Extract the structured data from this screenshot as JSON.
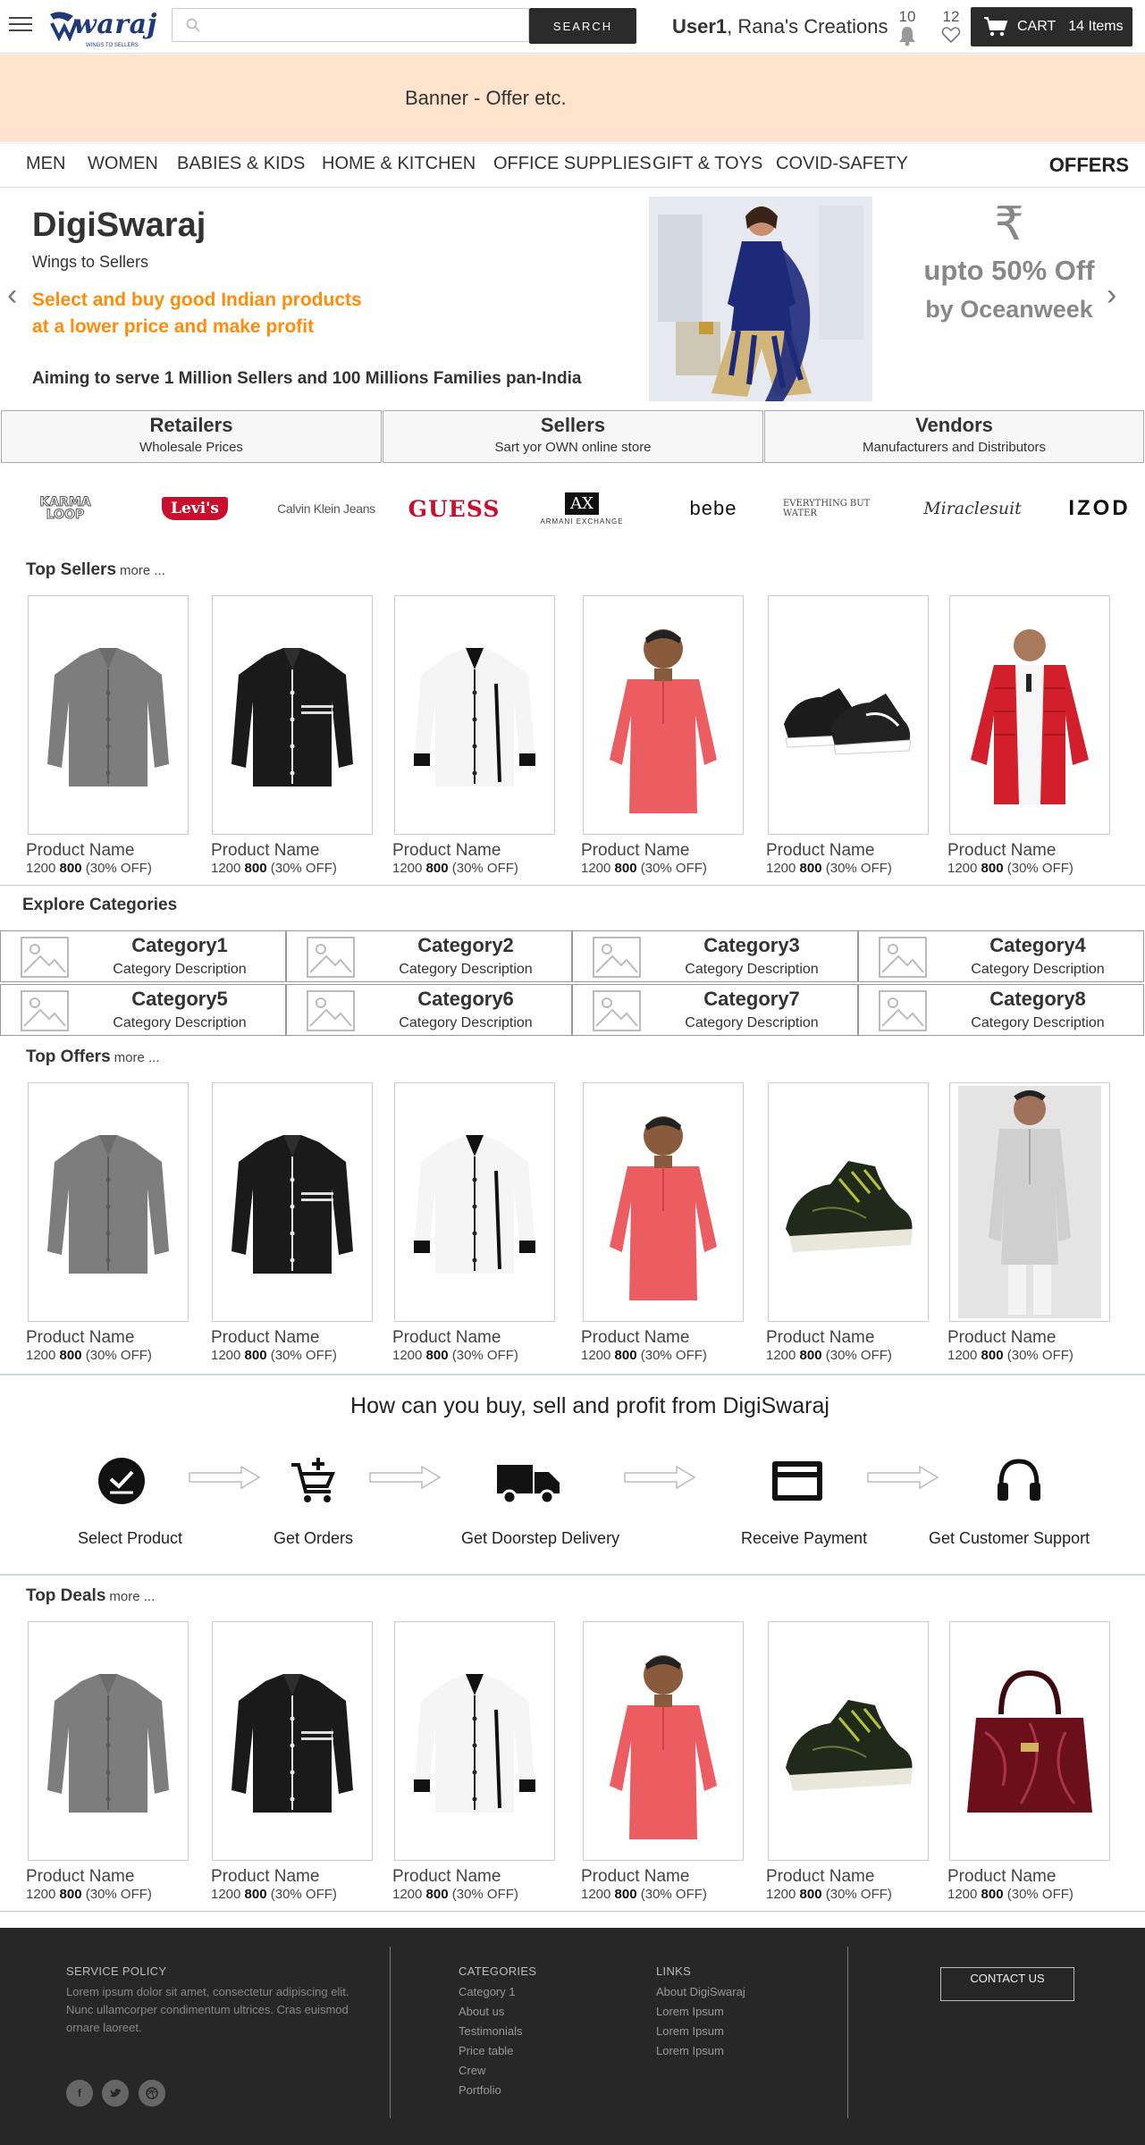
{
  "header": {
    "search_placeholder": "",
    "search_button": "SEARCH",
    "user_bold": "User1",
    "user_rest": ", Rana's Creations",
    "notifications_count": "10",
    "wishlist_count": "12",
    "cart_label": "CART",
    "cart_items": "14 Items"
  },
  "logo": {
    "text": "waraj"
  },
  "banner": {
    "text": "Banner - Offer etc."
  },
  "nav": {
    "items": [
      "MEN",
      "WOMEN",
      "BABIES & KIDS",
      "HOME & KITCHEN",
      "OFFICE SUPPLIES",
      "GIFT & TOYS",
      "COVID-SAFETY"
    ],
    "offers": "OFFERS"
  },
  "hero": {
    "title": "DigiSwaraj",
    "subtitle": "Wings to Sellers",
    "tagline_1": "Select and buy good Indian products",
    "tagline_2": "at a lower price and make profit",
    "aim": "Aiming to serve 1 Million Sellers and 100 Millions Families pan-India",
    "rupee": "₹",
    "offer": "upto 50% Off",
    "offer_by": "by Oceanweek",
    "prev": "‹",
    "next": "›"
  },
  "segments": [
    {
      "title": "Retailers",
      "desc": "Wholesale Prices"
    },
    {
      "title": "Sellers",
      "desc": "Sart yor OWN online store"
    },
    {
      "title": "Vendors",
      "desc": "Manufacturers and Distributors"
    }
  ],
  "brands": [
    "KARMA LOOP",
    "Levi's",
    "Calvin Klein Jeans",
    "GUESS",
    "AX",
    "ARMANI EXCHANGE",
    "bebe",
    "EVERYTHING BUT WATER",
    "Miraclesuit",
    "IZOD"
  ],
  "top_sellers": {
    "title": "Top Sellers",
    "more": "more ...",
    "products": [
      {
        "name": "Product Name",
        "mrp": "1200",
        "price": "800",
        "off": "(30% OFF)",
        "image": "grey-shirt"
      },
      {
        "name": "Product Name",
        "mrp": "1200",
        "price": "800",
        "off": "(30% OFF)",
        "image": "black-shirt"
      },
      {
        "name": "Product Name",
        "mrp": "1200",
        "price": "800",
        "off": "(30% OFF)",
        "image": "white-shirt"
      },
      {
        "name": "Product Name",
        "mrp": "1200",
        "price": "800",
        "off": "(30% OFF)",
        "image": "red-kurta"
      },
      {
        "name": "Product Name",
        "mrp": "1200",
        "price": "800",
        "off": "(30% OFF)",
        "image": "black-sneakers"
      },
      {
        "name": "Product Name",
        "mrp": "1200",
        "price": "800",
        "off": "(30% OFF)",
        "image": "red-jacket"
      }
    ]
  },
  "categories": {
    "title": "Explore Categories",
    "items": [
      {
        "name": "Category1",
        "desc": "Category Description"
      },
      {
        "name": "Category2",
        "desc": "Category Description"
      },
      {
        "name": "Category3",
        "desc": "Category Description"
      },
      {
        "name": "Category4",
        "desc": "Category Description"
      },
      {
        "name": "Category5",
        "desc": "Category Description"
      },
      {
        "name": "Category6",
        "desc": "Category Description"
      },
      {
        "name": "Category7",
        "desc": "Category Description"
      },
      {
        "name": "Category8",
        "desc": "Category Description"
      }
    ]
  },
  "top_offers": {
    "title": "Top Offers",
    "more": "more ...",
    "products": [
      {
        "name": "Product Name",
        "mrp": "1200",
        "price": "800",
        "off": "(30% OFF)",
        "image": "grey-shirt"
      },
      {
        "name": "Product Name",
        "mrp": "1200",
        "price": "800",
        "off": "(30% OFF)",
        "image": "black-shirt"
      },
      {
        "name": "Product Name",
        "mrp": "1200",
        "price": "800",
        "off": "(30% OFF)",
        "image": "white-shirt"
      },
      {
        "name": "Product Name",
        "mrp": "1200",
        "price": "800",
        "off": "(30% OFF)",
        "image": "red-kurta"
      },
      {
        "name": "Product Name",
        "mrp": "1200",
        "price": "800",
        "off": "(30% OFF)",
        "image": "green-sneaker"
      },
      {
        "name": "Product Name",
        "mrp": "1200",
        "price": "800",
        "off": "(30% OFF)",
        "image": "white-kurta"
      }
    ]
  },
  "how": {
    "title": "How can you buy, sell and profit from DigiSwaraj",
    "steps": [
      "Select Product",
      "Get Orders",
      "Get Doorstep Delivery",
      "Receive Payment",
      "Get Customer Support"
    ]
  },
  "top_deals": {
    "title": "Top Deals",
    "more": "more ...",
    "products": [
      {
        "name": "Product Name",
        "mrp": "1200",
        "price": "800",
        "off": "(30% OFF)",
        "image": "grey-shirt"
      },
      {
        "name": "Product Name",
        "mrp": "1200",
        "price": "800",
        "off": "(30% OFF)",
        "image": "black-shirt"
      },
      {
        "name": "Product Name",
        "mrp": "1200",
        "price": "800",
        "off": "(30% OFF)",
        "image": "white-shirt"
      },
      {
        "name": "Product Name",
        "mrp": "1200",
        "price": "800",
        "off": "(30% OFF)",
        "image": "red-kurta"
      },
      {
        "name": "Product Name",
        "mrp": "1200",
        "price": "800",
        "off": "(30% OFF)",
        "image": "green-sneaker"
      },
      {
        "name": "Product Name",
        "mrp": "1200",
        "price": "800",
        "off": "(30% OFF)",
        "image": "maroon-handbag"
      }
    ]
  },
  "footer": {
    "service_title": "SERVICE POLICY",
    "service_text": "Lorem ipsum dolor sit amet, consectetur adipiscing elit. Nunc ullamcorper condimentum ultrices. Cras euismod ornare laoreet.",
    "categories_title": "CATEGORIES",
    "categories": [
      "Category 1",
      "About us",
      "Testimonials",
      "Price table",
      "Crew",
      "Portfolio"
    ],
    "links_title": "LINKS",
    "links": [
      "About DigiSwaraj",
      "Lorem Ipsum",
      "Lorem Ipsum",
      "Lorem Ipsum"
    ],
    "contact": "CONTACT US",
    "social": [
      "f",
      "t",
      "dribbble"
    ]
  },
  "colors": {
    "banner_bg": "#ffe3cc",
    "accent_orange": "#ff8c0a",
    "dark_button": "#2b2b2b",
    "footer_bg": "#272727",
    "logo_blue": "#1f3a78"
  }
}
